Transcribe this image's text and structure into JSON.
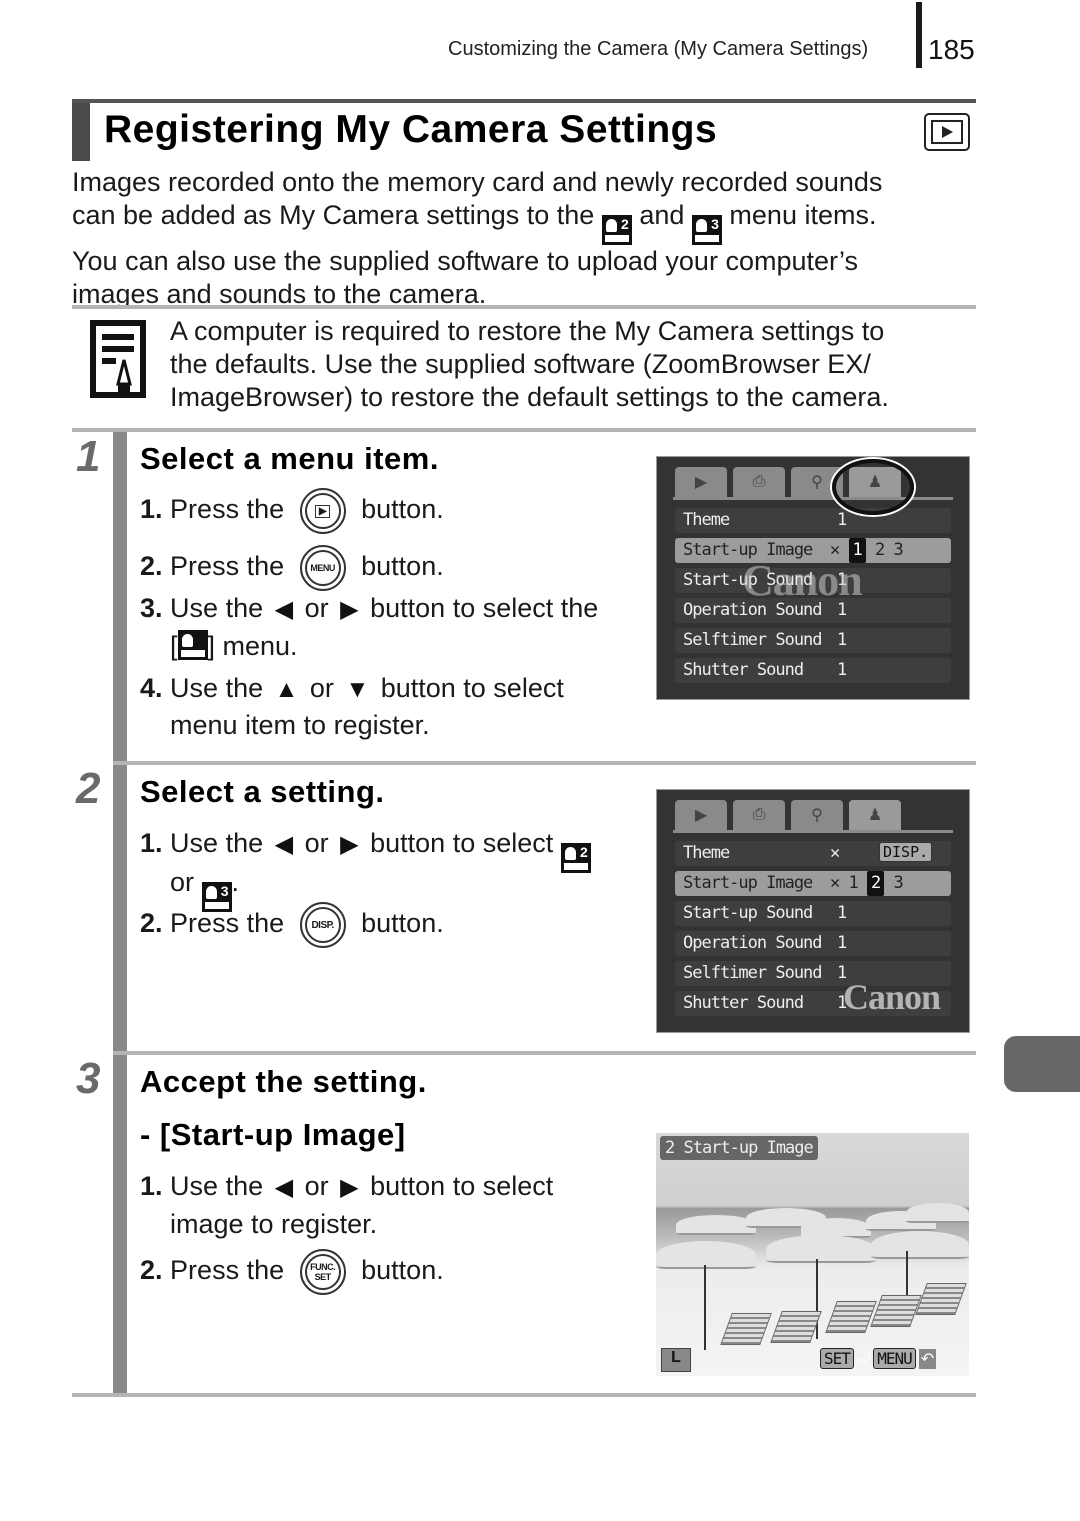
{
  "header": {
    "running_head": "Customizing the Camera (My Camera Settings)",
    "page_number": "185"
  },
  "title": {
    "text": "Registering My Camera Settings",
    "mode_icon": "playback-mode-icon"
  },
  "intro": {
    "line1": "Images recorded onto the memory card and newly recorded sounds",
    "line2_a": "can be added as My Camera settings to the",
    "icon_a": "2",
    "line2_b": "and",
    "icon_b": "3",
    "line2_c": "menu items.",
    "line3": "You can also use the supplied software to upload your computer’s",
    "line4": "images and sounds to the camera."
  },
  "note": {
    "icon": "memo-pencil-icon",
    "line1": "A computer is required to restore the My Camera settings to",
    "line2": "the defaults. Use the supplied software (ZoomBrowser EX/",
    "line3": "ImageBrowser) to restore the default settings to the camera."
  },
  "steps": [
    {
      "number": "1",
      "title": "Select a menu item.",
      "instructions": {
        "i1_num": "1.",
        "i1_a": "Press the",
        "i1_btn": "▶",
        "i1_b": "button.",
        "i2_num": "2.",
        "i2_a": "Press the",
        "i2_btn": "MENU",
        "i2_b": "button.",
        "i3_num": "3.",
        "i3_a": "Use the",
        "i3_left": "◆",
        "i3_or": "or",
        "i3_right": "◆",
        "i3_b": "button to select the",
        "i3_c_open": "[",
        "i3_c_close": "] menu.",
        "i4_num": "4.",
        "i4_a": "Use the",
        "i4_up": "▲",
        "i4_or": "or",
        "i4_down": "▼",
        "i4_b": "button to select",
        "i4_c": "menu item to register."
      },
      "screen": {
        "rows": [
          {
            "label": "Theme",
            "value": "1"
          },
          {
            "label": "Start-up Image",
            "value": "1",
            "selected": true
          },
          {
            "label": "Start-up Sound",
            "value": "1"
          },
          {
            "label": "Operation Sound",
            "value": "1"
          },
          {
            "label": "Selftimer Sound",
            "value": "1"
          },
          {
            "label": "Shutter Sound",
            "value": "1"
          }
        ],
        "watermark": "Canon",
        "opt_off": "✕",
        "opt_sel": "1",
        "opt_2": "2",
        "opt_3": "3"
      }
    },
    {
      "number": "2",
      "title": "Select a setting.",
      "instructions": {
        "i1_num": "1.",
        "i1_a": "Use the",
        "i1_left": "◆",
        "i1_or": "or",
        "i1_right": "◆",
        "i1_b": "button to select",
        "i1_c": "or",
        "i1_icon_a": "2",
        "i1_icon_b": "3",
        "i1_end": ".",
        "i2_num": "2.",
        "i2_a": "Press the",
        "i2_btn": "DISP.",
        "i2_b": "button."
      },
      "screen": {
        "rows": [
          {
            "label": "Theme",
            "value": ""
          },
          {
            "label": "Start-up Image",
            "value": "1",
            "selected": true
          },
          {
            "label": "Start-up Sound",
            "value": "1"
          },
          {
            "label": "Operation Sound",
            "value": "1"
          },
          {
            "label": "Selftimer Sound",
            "value": "1"
          },
          {
            "label": "Shutter Sound",
            "value": "1"
          }
        ],
        "disp_chip": "DISP.",
        "watermark": "Canon",
        "opt_off": "✕",
        "opt_sel": "2",
        "opt_3": "3"
      }
    },
    {
      "number": "3",
      "title": "Accept the setting.",
      "subtitle": "- [Start-up Image]",
      "instructions": {
        "i1_num": "1.",
        "i1_a": "Use the",
        "i1_left": "◆",
        "i1_or": "or",
        "i1_right": "◆",
        "i1_b": "button to select",
        "i1_c": "image to register.",
        "i2_num": "2.",
        "i2_a": "Press the",
        "i2_btn_top": "FUNC.",
        "i2_btn_bottom": "SET",
        "i2_b": "button."
      },
      "screen": {
        "label": "2 Start-up Image",
        "size": "L",
        "set": "SET",
        "menu": "MENU",
        "back": "↶"
      }
    }
  ]
}
